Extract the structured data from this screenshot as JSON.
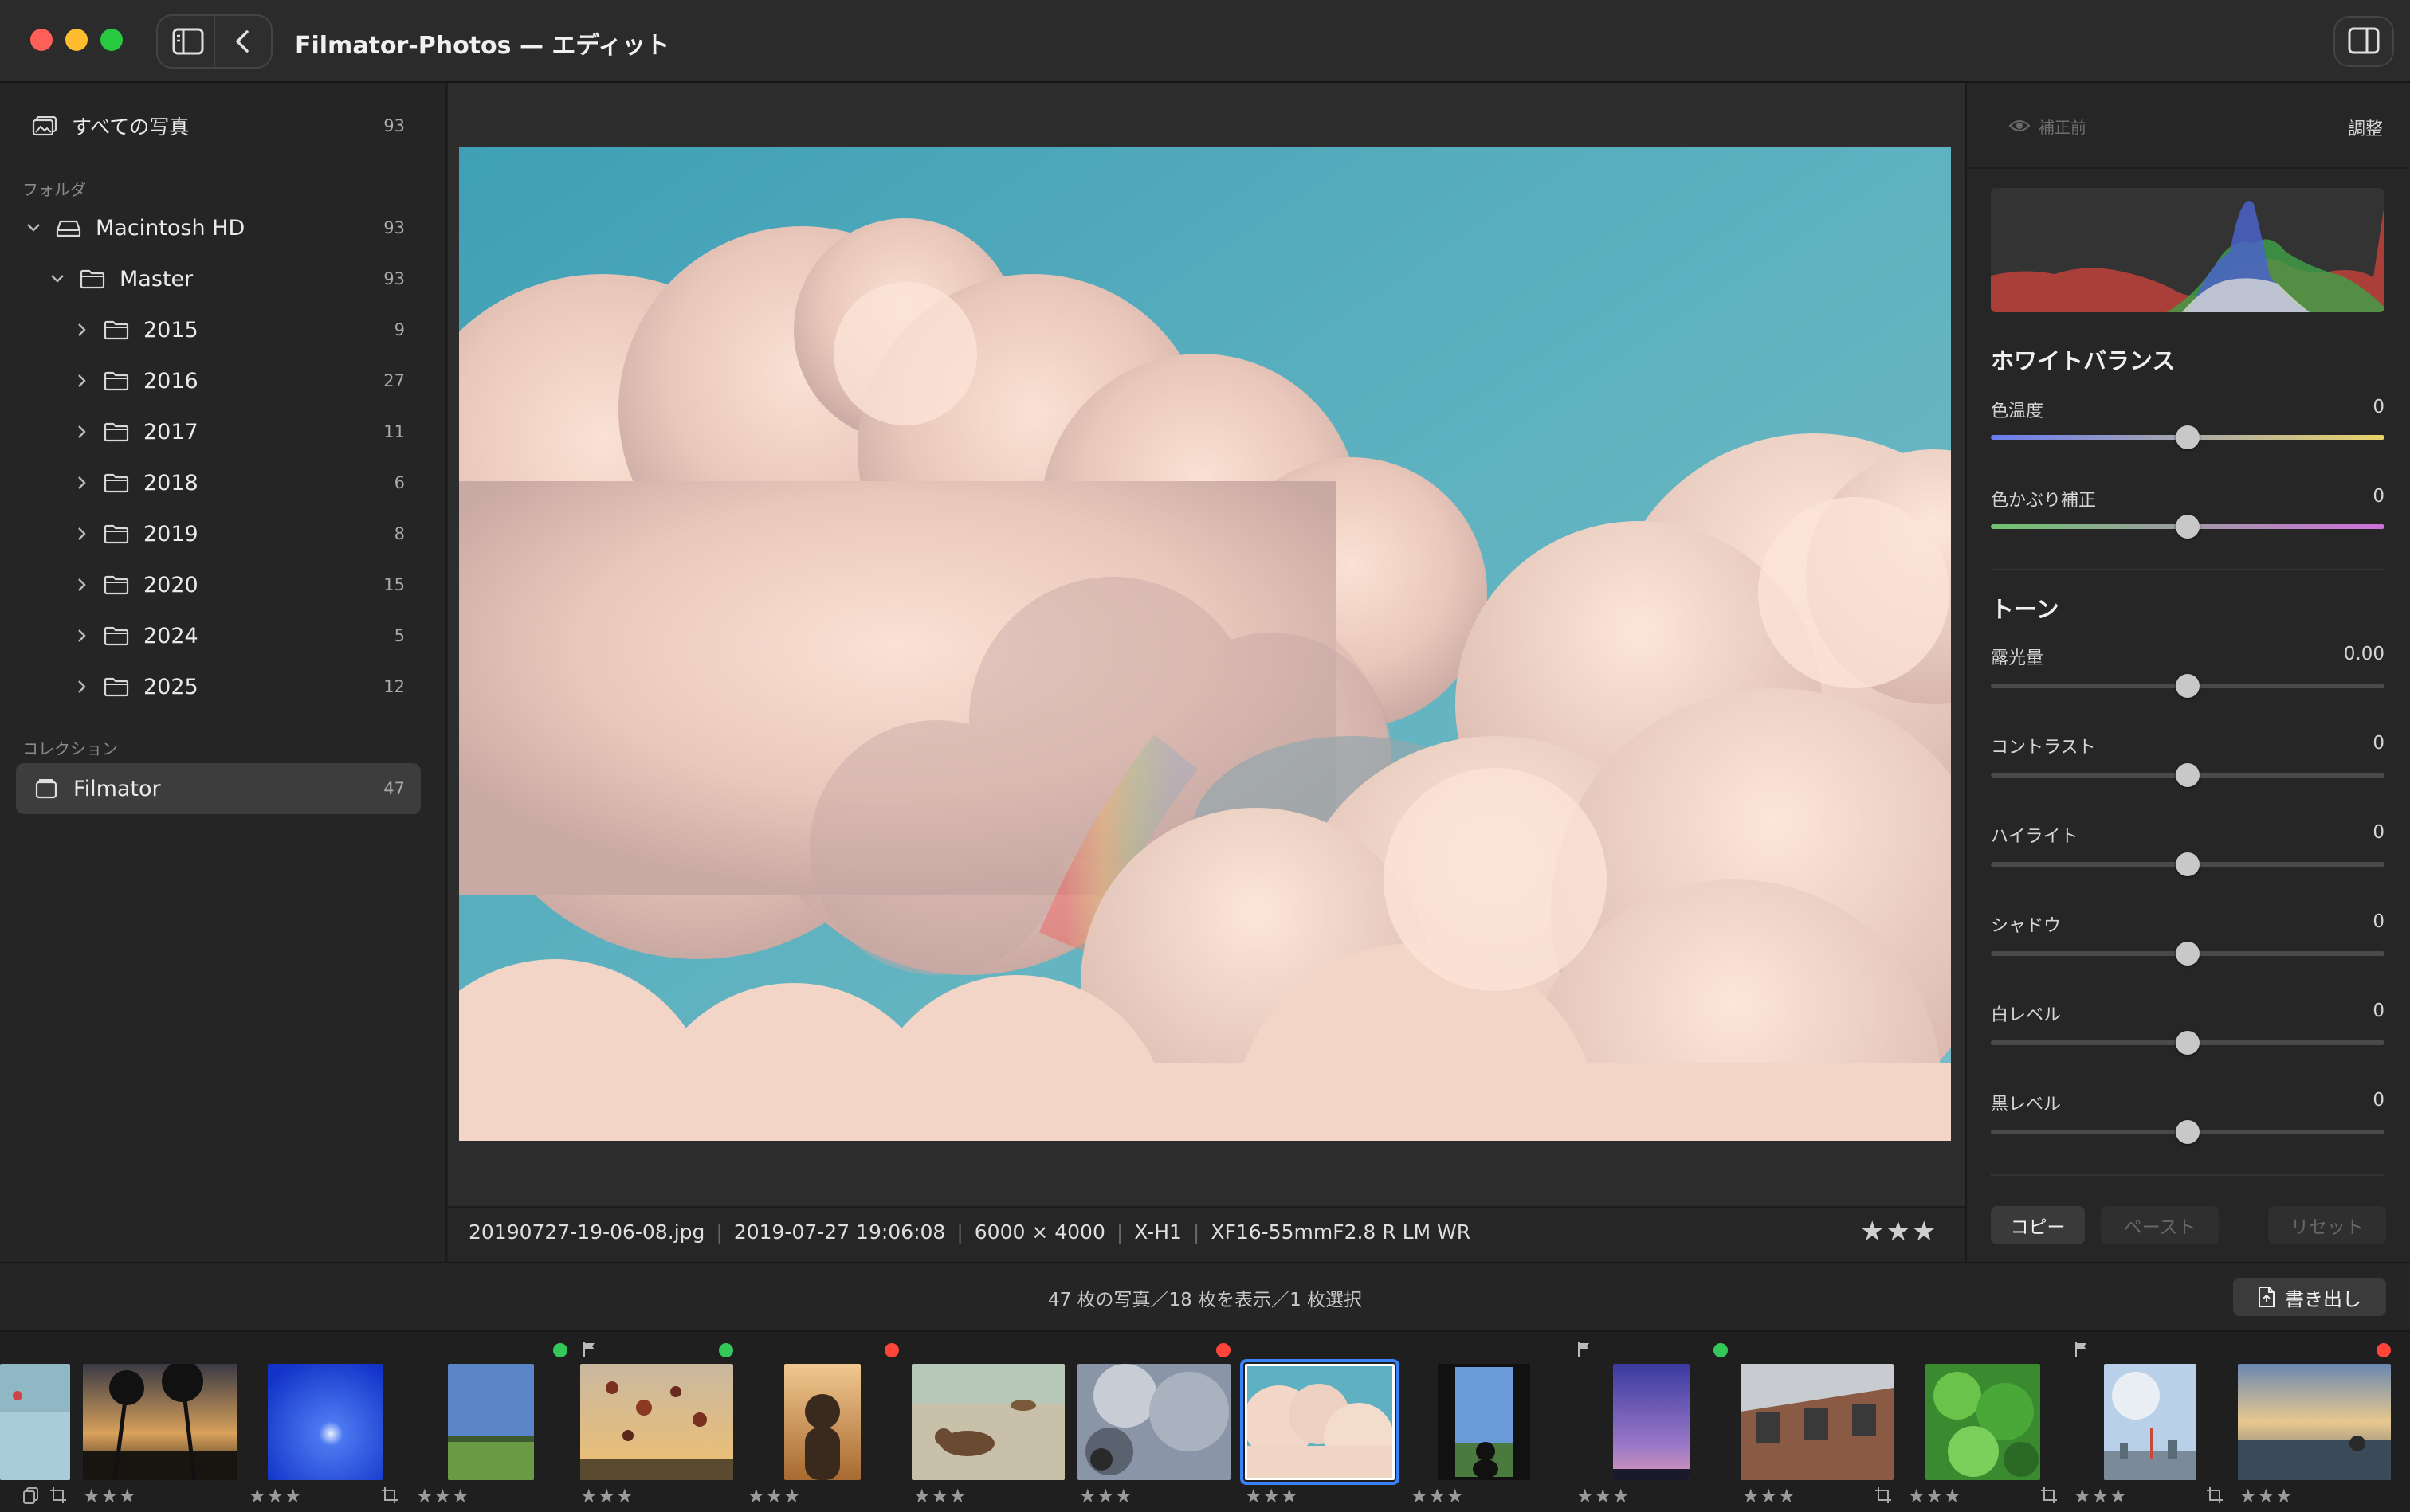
{
  "window": {
    "title": "Filmator-Photos — エディット"
  },
  "sidebar": {
    "all_photos": {
      "label": "すべての写真",
      "count": "93"
    },
    "folders_header": "フォルダ",
    "disk": {
      "label": "Macintosh HD",
      "count": "93"
    },
    "master": {
      "label": "Master",
      "count": "93"
    },
    "years": [
      {
        "label": "2015",
        "count": "9"
      },
      {
        "label": "2016",
        "count": "27"
      },
      {
        "label": "2017",
        "count": "11"
      },
      {
        "label": "2018",
        "count": "6"
      },
      {
        "label": "2019",
        "count": "8"
      },
      {
        "label": "2020",
        "count": "15"
      },
      {
        "label": "2024",
        "count": "5"
      },
      {
        "label": "2025",
        "count": "12"
      }
    ],
    "collections_header": "コレクション",
    "collection": {
      "label": "Filmator",
      "count": "47"
    }
  },
  "info": {
    "filename": "20190727-19-06-08.jpg",
    "datetime": "2019-07-27 19:06:08",
    "dimensions": "6000 × 4000",
    "camera": "X-H1",
    "lens": "XF16-55mmF2.8 R LM WR",
    "rating": 3
  },
  "inspector": {
    "before_label": "補正前",
    "adjust_label": "調整",
    "white_balance_title": "ホワイトバランス",
    "tone_title": "トーン",
    "sliders": [
      {
        "label": "色温度",
        "value": "0",
        "position": 0.5
      },
      {
        "label": "色かぶり補正",
        "value": "0",
        "position": 0.5
      },
      {
        "label": "露光量",
        "value": "0.00",
        "position": 0.5
      },
      {
        "label": "コントラスト",
        "value": "0",
        "position": 0.5
      },
      {
        "label": "ハイライト",
        "value": "0",
        "position": 0.5
      },
      {
        "label": "シャドウ",
        "value": "0",
        "position": 0.5
      },
      {
        "label": "白レベル",
        "value": "0",
        "position": 0.5
      },
      {
        "label": "黒レベル",
        "value": "0",
        "position": 0.5
      }
    ],
    "copy_label": "コピー",
    "paste_label": "ペースト",
    "reset_label": "リセット"
  },
  "status": {
    "text": "47 枚の写真／18 枚を表示／1 枚選択",
    "export_label": "書き出し"
  },
  "filmstrip": {
    "thumb_stars": "★★★",
    "info_stars": "★★★",
    "thumbs": [
      {
        "name": "thumb-1-blue-water"
      },
      {
        "name": "thumb-2-palm-sunset"
      },
      {
        "name": "thumb-3-blue-sky-sun"
      },
      {
        "name": "thumb-4-field-sky"
      },
      {
        "name": "thumb-5-balloons"
      },
      {
        "name": "thumb-6-child-sunset"
      },
      {
        "name": "thumb-7-dog-beach"
      },
      {
        "name": "thumb-8-gray-clouds"
      },
      {
        "name": "thumb-9-clouds-selected"
      },
      {
        "name": "thumb-10-cat-window"
      },
      {
        "name": "thumb-11-purple-sky"
      },
      {
        "name": "thumb-12-brick-building"
      },
      {
        "name": "thumb-13-green-leaves"
      },
      {
        "name": "thumb-14-city-skyline"
      },
      {
        "name": "thumb-15-sunset-coast"
      }
    ]
  },
  "colors": {
    "accent": "#3a82f7",
    "dot_green": "#34c759",
    "dot_red": "#ff453a",
    "traffic_red": "#fe5f57",
    "traffic_yellow": "#febc2e",
    "traffic_green": "#28c840"
  }
}
